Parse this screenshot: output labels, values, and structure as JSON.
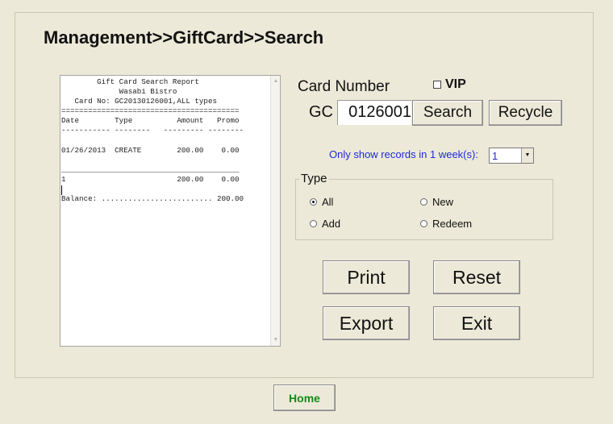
{
  "header": {
    "title": "Management>>GiftCard>>Search"
  },
  "report": {
    "lines": [
      "        Gift Card Search Report",
      "             Wasabi Bistro",
      "   Card No: GC20130126001,ALL types",
      "========================================",
      "Date        Type          Amount   Promo",
      "----------- --------   --------- --------",
      "",
      "01/26/2013  CREATE        200.00    0.00",
      "",
      "________________________________________",
      "1                         200.00    0.00",
      "",
      "Balance: ......................... 200.00"
    ]
  },
  "form": {
    "card_number_label": "Card Number",
    "vip_label": "VIP",
    "card_prefix": "GC",
    "card_value": "0126001",
    "search_label": "Search",
    "recycle_label": "Recycle",
    "week_label": "Only show records in 1 week(s):",
    "week_value": "1",
    "type_legend": "Type",
    "types": {
      "all": "All",
      "new": "New",
      "add": "Add",
      "redeem": "Redeem"
    },
    "selected_type": "All"
  },
  "actions": {
    "print": "Print",
    "reset": "Reset",
    "export": "Export",
    "exit": "Exit"
  },
  "footer": {
    "home": "Home"
  },
  "colors": {
    "background": "#ece9d8",
    "link_blue": "#1f2ad8",
    "home_green": "#148a14"
  }
}
